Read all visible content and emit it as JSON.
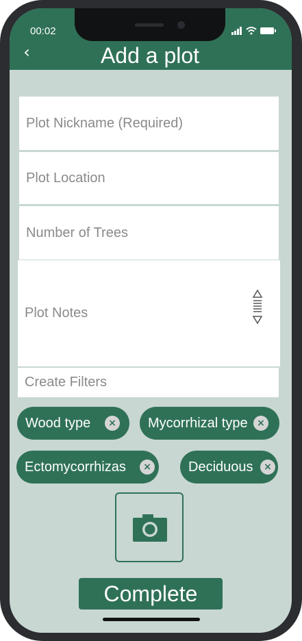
{
  "status_bar": {
    "time": "00:02",
    "icons": [
      "signal-icon",
      "wifi-icon",
      "battery-icon"
    ]
  },
  "header": {
    "back_icon": "back-chevron-icon",
    "back_glyph": "‹",
    "title": "Add a plot"
  },
  "form": {
    "plot_nickname": {
      "placeholder": "Plot Nickname (Required)",
      "value": ""
    },
    "plot_location": {
      "placeholder": "Plot Location",
      "value": ""
    },
    "number_of_trees": {
      "placeholder": "Number of Trees",
      "value": ""
    },
    "plot_notes": {
      "placeholder": "Plot Notes",
      "value": "",
      "resize_icon": "sort-handle-icon"
    },
    "create_filters": {
      "placeholder": "Create Filters",
      "value": ""
    }
  },
  "filters": [
    {
      "label": "Wood type",
      "remove_glyph": "×"
    },
    {
      "label": "Mycorrhizal type",
      "remove_glyph": "×"
    },
    {
      "label": "Ectomycorrhizas",
      "remove_glyph": "×"
    },
    {
      "label": "Deciduous",
      "remove_glyph": "×"
    }
  ],
  "camera": {
    "icon": "camera-icon"
  },
  "complete_button": {
    "label": "Complete"
  },
  "colors": {
    "primary": "#2f7157",
    "background": "#c8d7d2",
    "field": "#ffffff",
    "placeholder": "#8a8a8a",
    "chip_close": "#d5d5d5"
  }
}
